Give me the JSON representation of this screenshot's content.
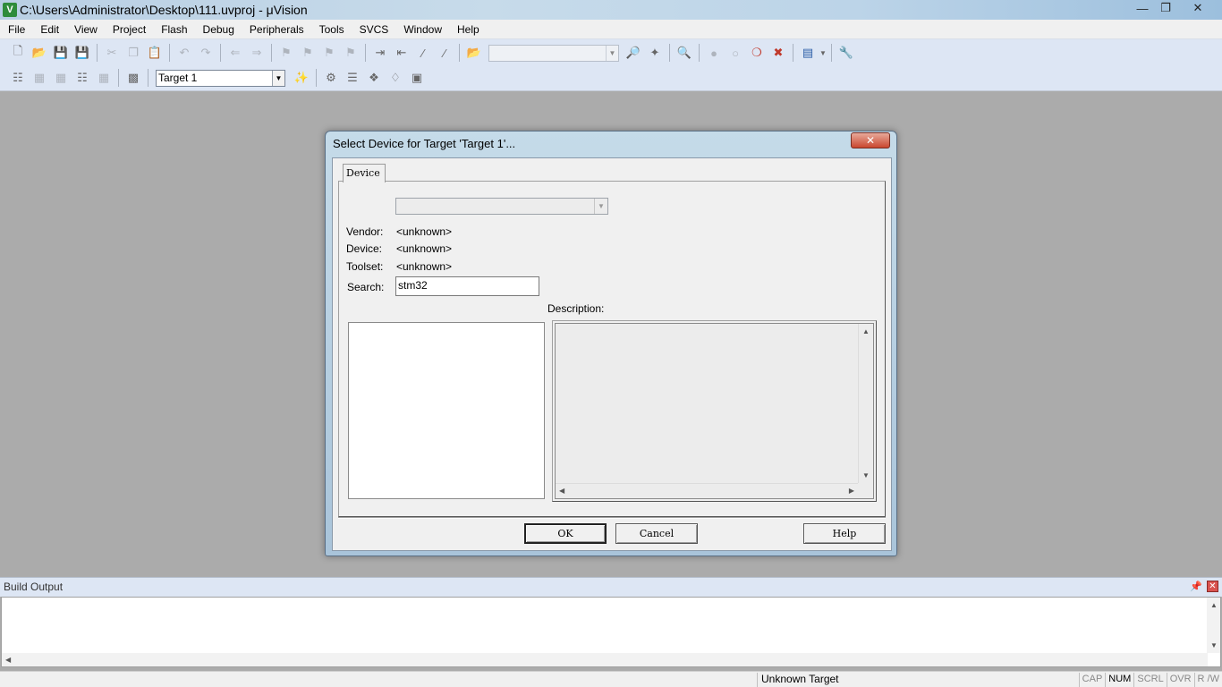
{
  "window": {
    "title": "C:\\Users\\Administrator\\Desktop\\111.uvproj - μVision",
    "app_icon": "V"
  },
  "menu": [
    "File",
    "Edit",
    "View",
    "Project",
    "Flash",
    "Debug",
    "Peripherals",
    "Tools",
    "SVCS",
    "Window",
    "Help"
  ],
  "toolbar": {
    "target_combo_value": "Target 1"
  },
  "dialog": {
    "title": "Select Device for Target 'Target 1'...",
    "tab_device": "Device",
    "vendor_label": "Vendor:",
    "vendor_value": "<unknown>",
    "device_label": "Device:",
    "device_value": "<unknown>",
    "toolset_label": "Toolset:",
    "toolset_value": "<unknown>",
    "search_label": "Search:",
    "search_value": "stm32",
    "description_label": "Description:",
    "ok_label": "OK",
    "cancel_label": "Cancel",
    "help_label": "Help"
  },
  "build_output": {
    "title": "Build Output"
  },
  "statusbar": {
    "target": "Unknown Target",
    "keys": [
      "CAP",
      "NUM",
      "SCRL",
      "OVR",
      "R /W"
    ],
    "active_key": "NUM"
  }
}
